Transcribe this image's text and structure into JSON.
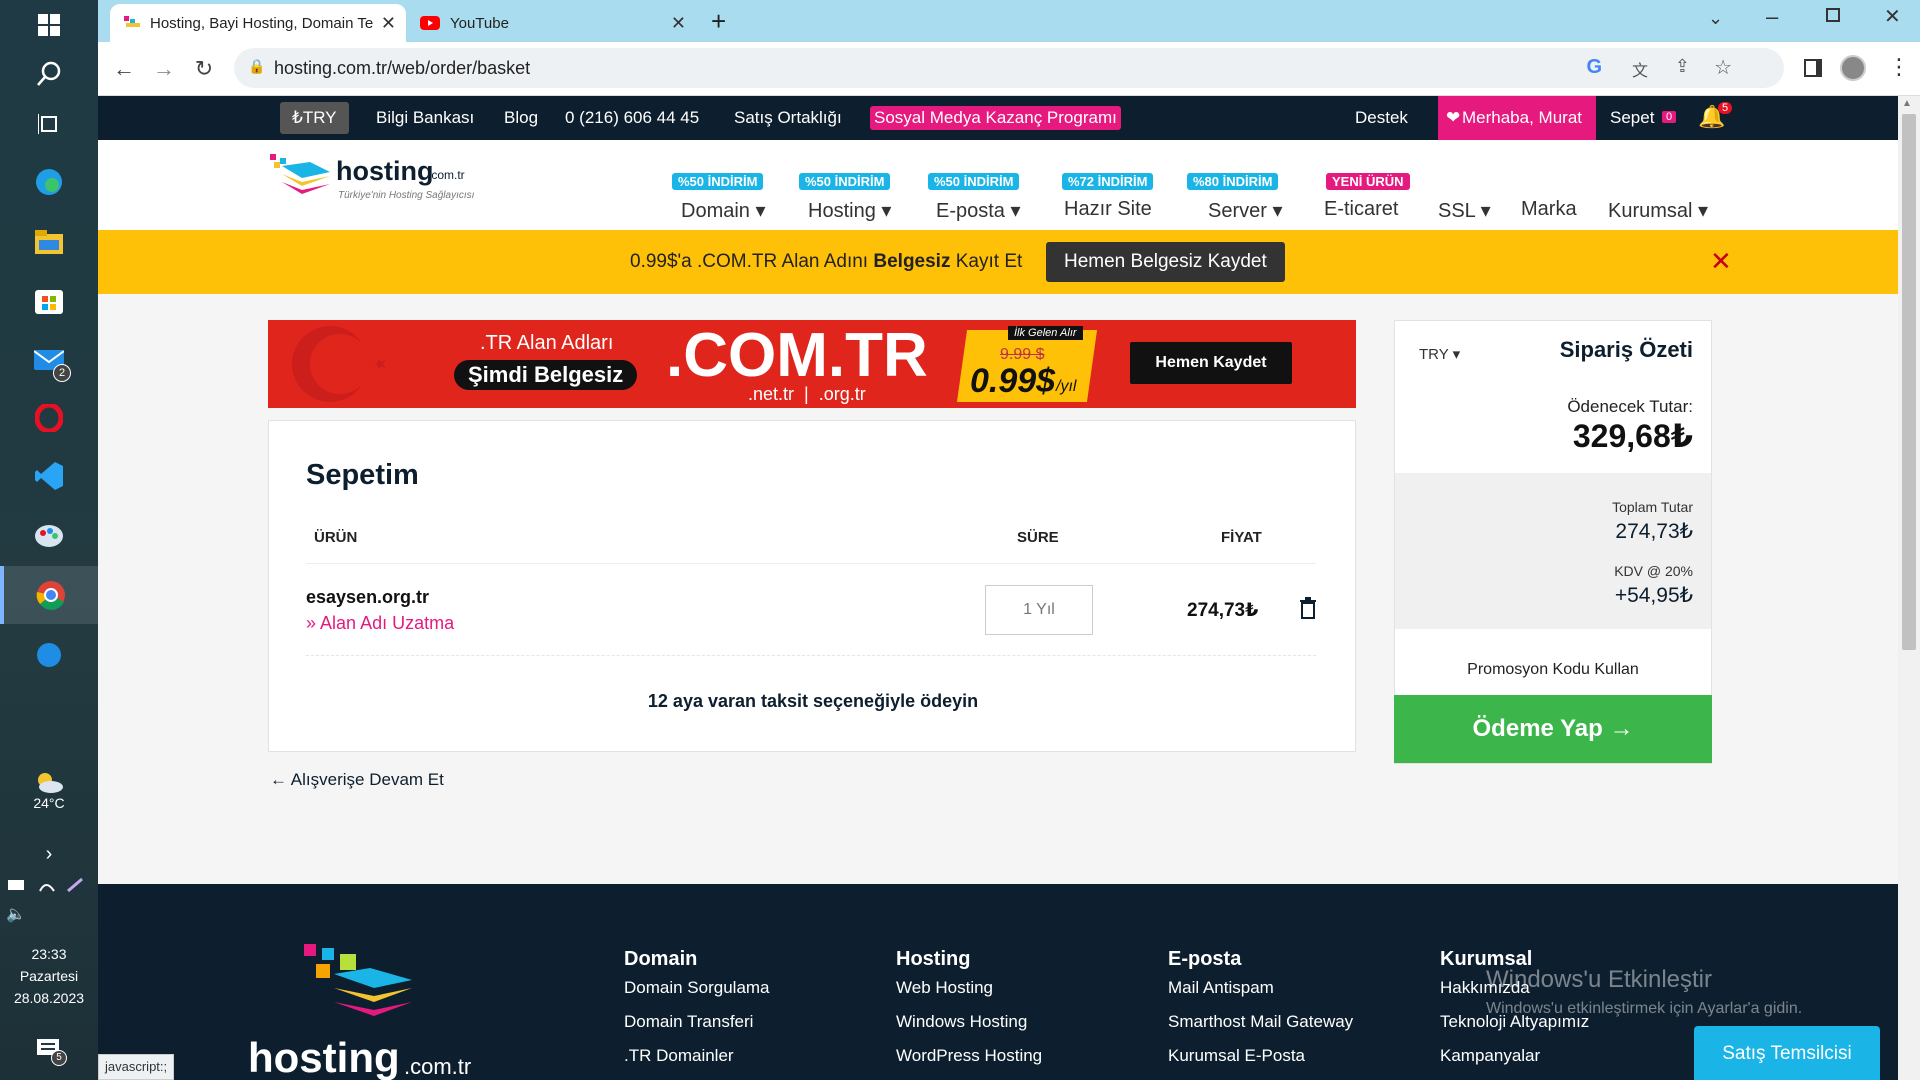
{
  "taskbar": {
    "weather_temp": "24°C",
    "time": "23:33",
    "day": "Pazartesi",
    "date": "28.08.2023",
    "mail_badge": "2",
    "notif_badge": "5"
  },
  "browser": {
    "tabs": [
      {
        "label": "Hosting, Bayi Hosting, Domain Te"
      },
      {
        "label": "YouTube"
      }
    ],
    "url": "hosting.com.tr/web/order/basket",
    "status_text": "javascript:;"
  },
  "site": {
    "topbar": {
      "currency": "₺TRY",
      "links": [
        "Bilgi Bankası",
        "Blog",
        "0 (216) 606 44 45",
        "Satış Ortaklığı"
      ],
      "promo_link": "Sosyal Medya Kazanç Programı",
      "support": "Destek",
      "greeting": "Merhaba, Murat",
      "cart": "Sepet",
      "cart_count": "0",
      "notif_count": "5"
    },
    "logo": {
      "text": "hosting",
      "suffix": ".com.tr",
      "tagline": "Türkiye'nin Hosting Sağlayıcısı"
    },
    "nav": [
      {
        "label": "Domain",
        "badge": "%50 İNDİRİM"
      },
      {
        "label": "Hosting",
        "badge": "%50 İNDİRİM"
      },
      {
        "label": "E-posta",
        "badge": "%50 İNDİRİM"
      },
      {
        "label": "Hazır Site",
        "badge": "%72 İNDİRİM"
      },
      {
        "label": "Server",
        "badge": "%80 İNDİRİM"
      },
      {
        "label": "E-ticaret",
        "badge": "YENİ ÜRÜN"
      },
      {
        "label": "SSL",
        "badge": ""
      },
      {
        "label": "Marka",
        "badge": ""
      },
      {
        "label": "Kurumsal",
        "badge": ""
      }
    ],
    "promo_bar": {
      "text_pre": "0.99$'a .COM.TR Alan Adını ",
      "text_bold": "Belgesiz",
      "text_post": " Kayıt Et",
      "button": "Hemen Belgesiz Kaydet"
    },
    "banner": {
      "line1": ".TR Alan Adları",
      "line2": "Şimdi Belgesiz",
      "big": ".COM.TR",
      "sub": ".net.tr  |  .org.tr",
      "tag": "İlk Gelen Alır",
      "old_price": "9.99 $",
      "price": "0.99$",
      "per": "/yıl",
      "button": "Hemen Kaydet"
    },
    "cart": {
      "title": "Sepetim",
      "headers": {
        "product": "ÜRÜN",
        "duration": "SÜRE",
        "price": "FİYAT"
      },
      "items": [
        {
          "name": "esaysen.org.tr",
          "type": "Alan Adı Uzatma",
          "duration": "1 Yıl",
          "price": "274,73₺"
        }
      ],
      "installment": "12 aya varan taksit seçeneğiyle ödeyin"
    },
    "continue_link": "Alışverişe Devam Et",
    "summary": {
      "currency": "TRY",
      "title": "Sipariş Özeti",
      "due_label": "Ödenecek Tutar:",
      "due_amount": "329,68₺",
      "total_label": "Toplam Tutar",
      "total_amount": "274,73₺",
      "vat_label": "KDV @ 20%",
      "vat_amount": "+54,95₺",
      "promo": "Promosyon Kodu Kullan",
      "pay_button": "Ödeme Yap"
    },
    "footer": {
      "logo": "hosting",
      "logo_suffix": ".com.tr",
      "columns": [
        {
          "title": "Domain",
          "links": [
            "Domain Sorgulama",
            "Domain Transferi",
            ".TR Domainler"
          ]
        },
        {
          "title": "Hosting",
          "links": [
            "Web Hosting",
            "Windows Hosting",
            "WordPress Hosting"
          ]
        },
        {
          "title": "E-posta",
          "links": [
            "Mail Antispam",
            "Smarthost Mail Gateway",
            "Kurumsal E-Posta"
          ]
        },
        {
          "title": "Kurumsal",
          "links": [
            "Hakkımızda",
            "Teknoloji Altyapımız",
            "Kampanyalar"
          ]
        }
      ],
      "sales_button": "Satış Temsilcisi"
    },
    "watermark": {
      "title": "Windows'u Etkinleştir",
      "sub": "Windows'u etkinleştirmek için Ayarlar'a gidin."
    }
  },
  "colors": {
    "primary_dark": "#0d1f2e",
    "pink": "#e6197e",
    "yellow": "#ffc107",
    "green": "#3cb54a",
    "cyan": "#1ab5e6"
  }
}
